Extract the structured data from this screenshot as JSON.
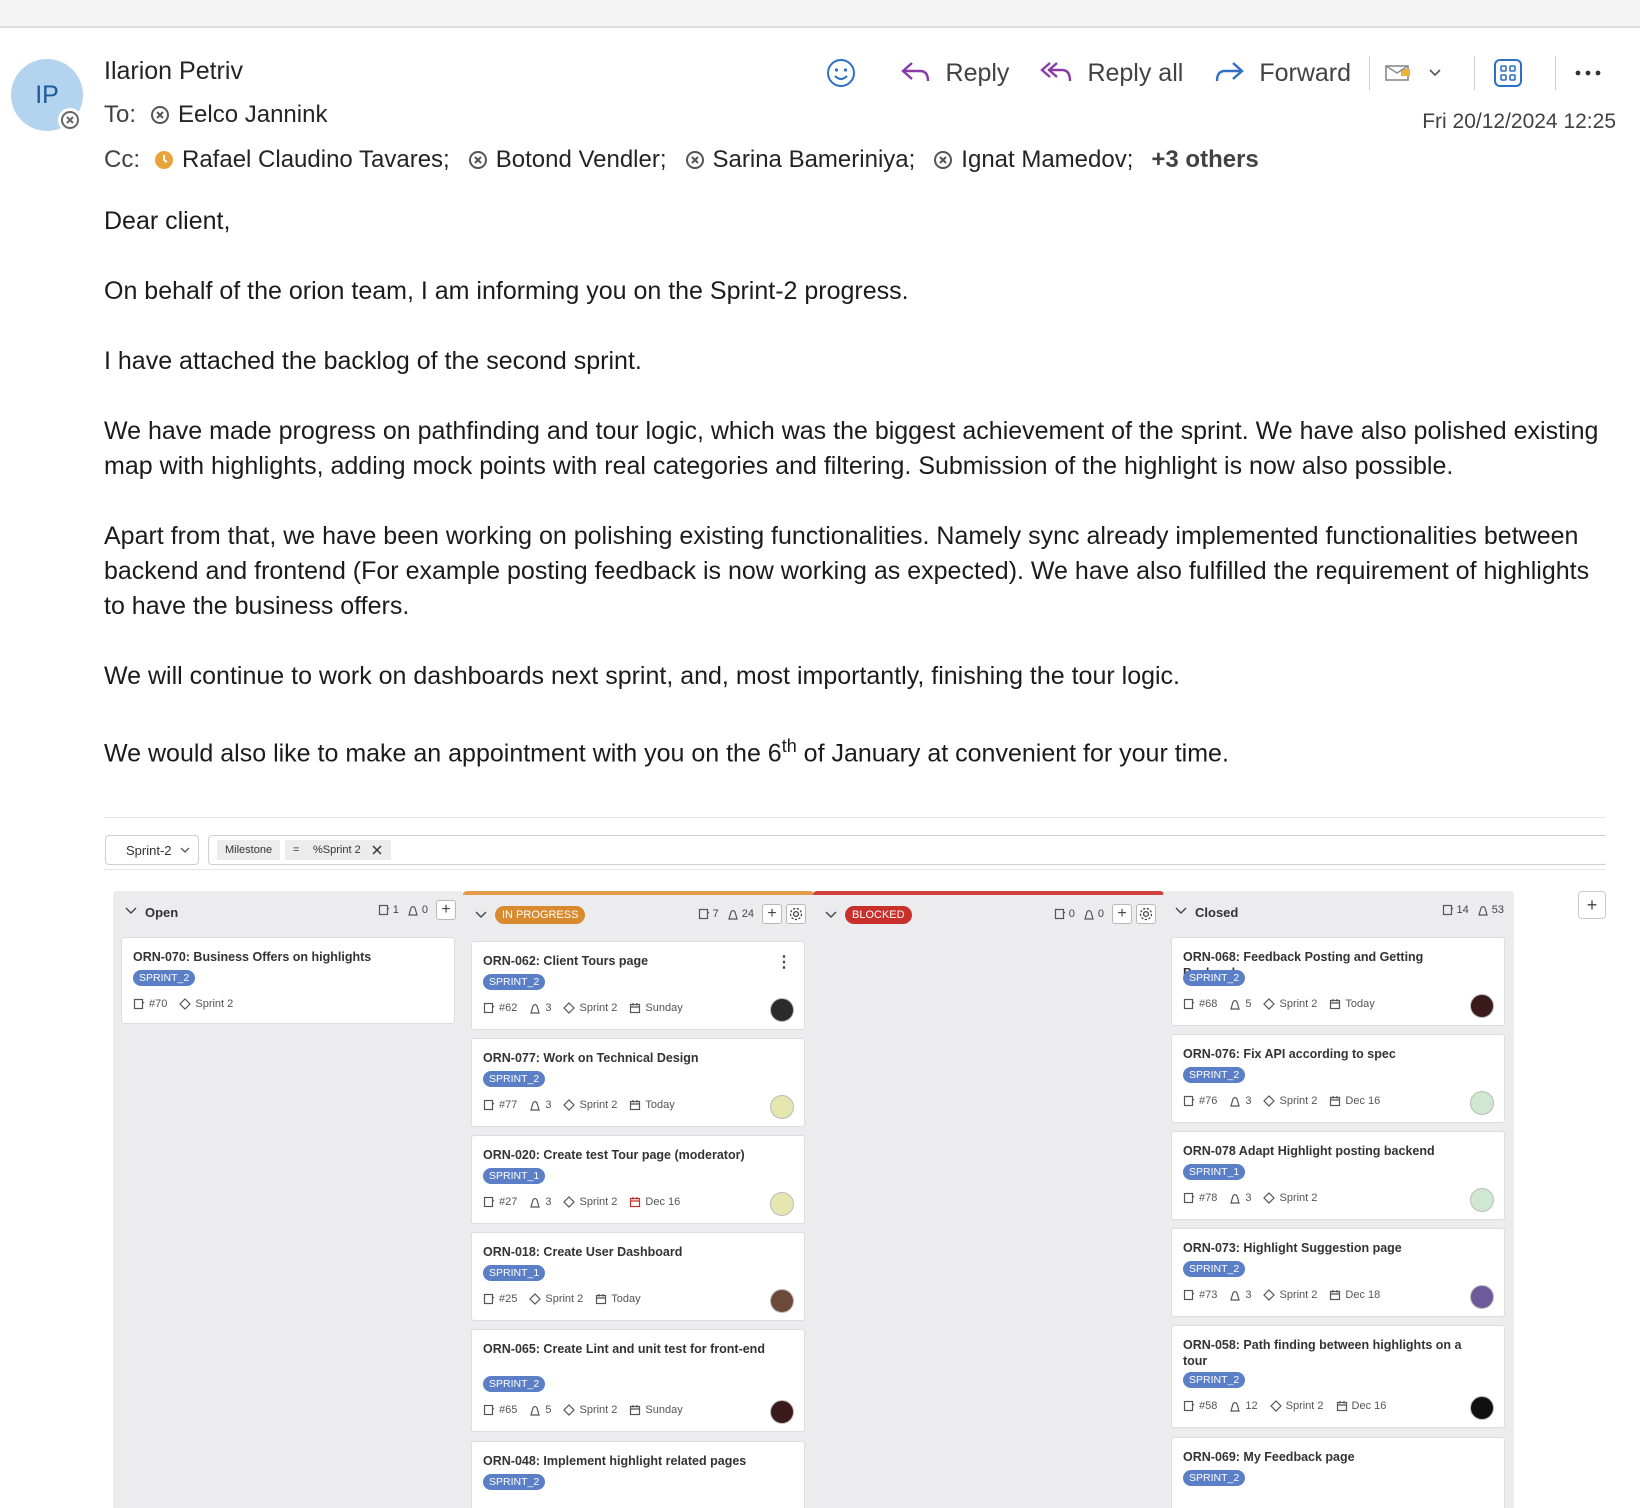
{
  "email": {
    "avatar_initials": "IP",
    "sender": "Ilarion Petriv",
    "to_label": "To:",
    "to": [
      "Eelco Jannink"
    ],
    "cc_label": "Cc:",
    "cc": [
      "Rafael Claudino Tavares;",
      "Botond Vendler;",
      "Sarina Bameriniya;",
      "Ignat Mamedov;"
    ],
    "cc_more": "+3 others",
    "date": "Fri 20/12/2024 12:25",
    "actions": {
      "reply": "Reply",
      "reply_all": "Reply all",
      "forward": "Forward"
    },
    "body": {
      "greeting": "Dear client,",
      "p1": "On behalf of the orion team, I am informing you on the Sprint-2 progress.",
      "p2": "I have attached the backlog of the second sprint.",
      "p3": "We have made progress on pathfinding and tour logic, which was the biggest achievement of the sprint. We have also polished existing map with highlights, adding mock points with real categories and filtering. Submission of the highlight is now also possible.",
      "p4": "Apart from that, we have been working on polishing existing functionalities. Namely sync already implemented functionalities between backend and frontend (For example posting feedback is now working as expected). We have also fulfilled the requirement of highlights to have the business offers.",
      "p5": "We will continue to work on dashboards next sprint, and, most importantly, finishing the tour logic.",
      "p6_before": "We would also like to make an appointment with you on the 6",
      "p6_sup": "th",
      "p6_after": " of January at convenient for your time."
    }
  },
  "board": {
    "sprint_select": "Sprint-2",
    "filter": {
      "field": "Milestone",
      "op": "=",
      "value": "%Sprint 2"
    },
    "columns": [
      {
        "title": "Open",
        "issues": "1",
        "weight": "0",
        "cards": [
          {
            "title": "ORN-070: Business Offers on highlights",
            "tag": "SPRINT_2",
            "id": "#70",
            "weight": "",
            "milestone": "Sprint 2",
            "due": ""
          }
        ]
      },
      {
        "title": "IN PROGRESS",
        "issues": "7",
        "weight": "24",
        "cards": [
          {
            "title": "ORN-062: Client Tours page",
            "tag": "SPRINT_2",
            "id": "#62",
            "weight": "3",
            "milestone": "Sprint 2",
            "due": "Sunday"
          },
          {
            "title": "ORN-077: Work on Technical Design",
            "tag": "SPRINT_2",
            "id": "#77",
            "weight": "3",
            "milestone": "Sprint 2",
            "due": "Today"
          },
          {
            "title": "ORN-020: Create test Tour page (moderator)",
            "tag": "SPRINT_1",
            "id": "#27",
            "weight": "3",
            "milestone": "Sprint 2",
            "due": "Dec 16"
          },
          {
            "title": "ORN-018: Create User Dashboard",
            "tag": "SPRINT_1",
            "id": "#25",
            "weight": "",
            "milestone": "Sprint 2",
            "due": "Today"
          },
          {
            "title": "ORN-065: Create Lint and unit test for front-end",
            "tag": "SPRINT_2",
            "id": "#65",
            "weight": "5",
            "milestone": "Sprint 2",
            "due": "Sunday"
          },
          {
            "title": "ORN-048: Implement highlight related pages",
            "tag": "SPRINT_2",
            "id": "",
            "weight": "",
            "milestone": "",
            "due": ""
          }
        ]
      },
      {
        "title": "BLOCKED",
        "issues": "0",
        "weight": "0",
        "cards": []
      },
      {
        "title": "Closed",
        "issues": "14",
        "weight": "53",
        "cards": [
          {
            "title": "ORN-068: Feedback Posting and Getting Backend",
            "tag": "SPRINT_2",
            "id": "#68",
            "weight": "5",
            "milestone": "Sprint 2",
            "due": "Today"
          },
          {
            "title": "ORN-076: Fix API according to spec",
            "tag": "SPRINT_2",
            "id": "#76",
            "weight": "3",
            "milestone": "Sprint 2",
            "due": "Dec 16"
          },
          {
            "title": "ORN-078 Adapt Highlight posting backend",
            "tag": "SPRINT_1",
            "id": "#78",
            "weight": "3",
            "milestone": "Sprint 2",
            "due": ""
          },
          {
            "title": "ORN-073: Highlight Suggestion page",
            "tag": "SPRINT_2",
            "id": "#73",
            "weight": "3",
            "milestone": "Sprint 2",
            "due": "Dec 18"
          },
          {
            "title": "ORN-058: Path finding between highlights on a tour",
            "tag": "SPRINT_2",
            "id": "#58",
            "weight": "12",
            "milestone": "Sprint 2",
            "due": "Dec 16"
          },
          {
            "title": "ORN-069: My Feedback page",
            "tag": "SPRINT_2",
            "id": "",
            "weight": "",
            "milestone": "",
            "due": ""
          }
        ]
      }
    ]
  }
}
